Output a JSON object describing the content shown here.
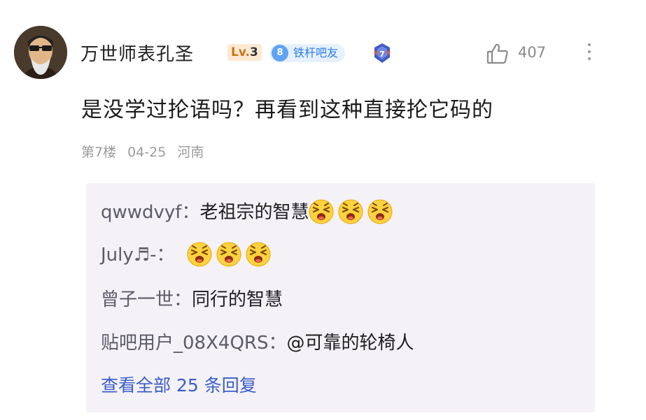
{
  "post": {
    "username": "万世师表孔圣",
    "level_prefix": "Lv.",
    "level_number": "3",
    "tieba_badge_number": "8",
    "tieba_badge_label": "铁杆吧友",
    "like_count": "407",
    "content": "是没学过抡语吗？再看到这种直接抡它码的",
    "floor": "第7楼",
    "date": "04-25",
    "location": "河南"
  },
  "replies": [
    {
      "user": "qwwdvyf：",
      "text": "老祖宗的智慧",
      "emoji_count": 3
    },
    {
      "user": "July♬-：",
      "text": "",
      "emoji_count": 3
    },
    {
      "user": "曾子一世：",
      "text": "同行的智慧",
      "emoji_count": 0
    },
    {
      "user": "贴吧用户_08X4QRS：",
      "text": "@可靠的轮椅人",
      "emoji_count": 0
    }
  ],
  "view_all": "查看全部 25 条回复",
  "colors": {
    "accent_blue": "#3a5ec9",
    "reply_bg": "#f4f1f7",
    "badge_blue": "#2e7be6",
    "level_orange": "#c9731a"
  },
  "icons": [
    "avatar-icon",
    "medal-icon",
    "thumbs-up-icon",
    "more-vertical-icon",
    "laughing-emoji-icon"
  ]
}
